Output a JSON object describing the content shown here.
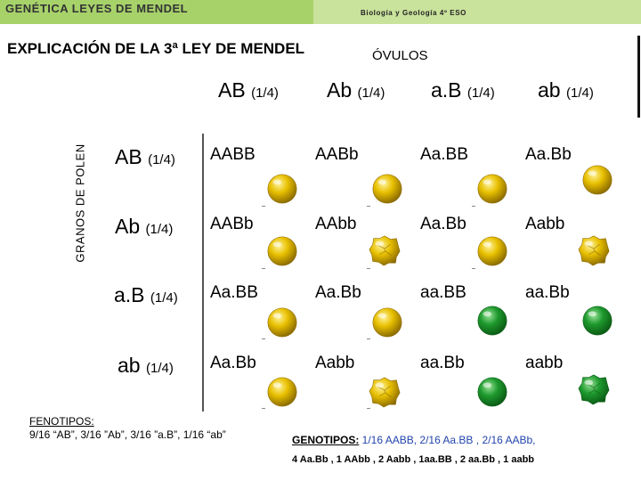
{
  "header": {
    "title": "GENÉTICA LEYES DE MENDEL",
    "subtitle": "Biología y Geología 4º ESO"
  },
  "slide": {
    "title": "EXPLICACIÓN DE LA 3ª LEY DE MENDEL",
    "ovulos_label": "ÓVULOS",
    "polen_label": "GRANOS DE POLEN"
  },
  "columns": [
    {
      "gamete": "AB",
      "fraction": "(1/4)"
    },
    {
      "gamete": "Ab",
      "fraction": "(1/4)"
    },
    {
      "gamete": "a.B",
      "fraction": "(1/4)"
    },
    {
      "gamete": "ab",
      "fraction": "(1/4)"
    }
  ],
  "rows": [
    {
      "gamete": "AB",
      "fraction": "(1/4)"
    },
    {
      "gamete": "Ab",
      "fraction": "(1/4)"
    },
    {
      "gamete": "a.B",
      "fraction": "(1/4)"
    },
    {
      "gamete": "ab",
      "fraction": "(1/4)"
    }
  ],
  "cells": [
    [
      {
        "genotype": "AABB",
        "pea": "yellow-smooth"
      },
      {
        "genotype": "AABb",
        "pea": "yellow-smooth"
      },
      {
        "genotype": "Aa.BB",
        "pea": "yellow-smooth"
      },
      {
        "genotype": "Aa.Bb",
        "pea": "yellow-smooth"
      }
    ],
    [
      {
        "genotype": "AABb",
        "pea": "yellow-smooth"
      },
      {
        "genotype": "AAbb",
        "pea": "yellow-wrinkled"
      },
      {
        "genotype": "Aa.Bb",
        "pea": "yellow-smooth"
      },
      {
        "genotype": "Aabb",
        "pea": "yellow-wrinkled"
      }
    ],
    [
      {
        "genotype": "Aa.BB",
        "pea": "yellow-smooth"
      },
      {
        "genotype": "Aa.Bb",
        "pea": "yellow-smooth"
      },
      {
        "genotype": "aa.BB",
        "pea": "green-smooth"
      },
      {
        "genotype": "aa.Bb",
        "pea": "green-smooth"
      }
    ],
    [
      {
        "genotype": "Aa.Bb",
        "pea": "yellow-smooth"
      },
      {
        "genotype": "Aabb",
        "pea": "yellow-wrinkled"
      },
      {
        "genotype": "aa.Bb",
        "pea": "green-smooth"
      },
      {
        "genotype": "aabb",
        "pea": "green-wrinkled"
      }
    ]
  ],
  "footer": {
    "fenotipos_label": "FENOTIPOS:",
    "fenotipos_text": "9/16 “AB”, 3/16 ”Ab”, 3/16 ”a.B”, 1/16 “ab”",
    "genotipos_label": "GENOTIPOS:",
    "genotipos_line1": " 1/16 AABB, 2/16 Aa.BB , 2/16 AABb,",
    "genotipos_line2": "4 Aa.Bb , 1 AAbb , 2 Aabb , 1aa.BB , 2 aa.Bb , 1 aabb"
  },
  "colors": {
    "header_green": "#a7d26a",
    "header_light_green": "#c9e29c",
    "pea_yellow": "#e8c000",
    "pea_green": "#1e9a2e",
    "genotipos_value_blue": "#2244aa"
  }
}
